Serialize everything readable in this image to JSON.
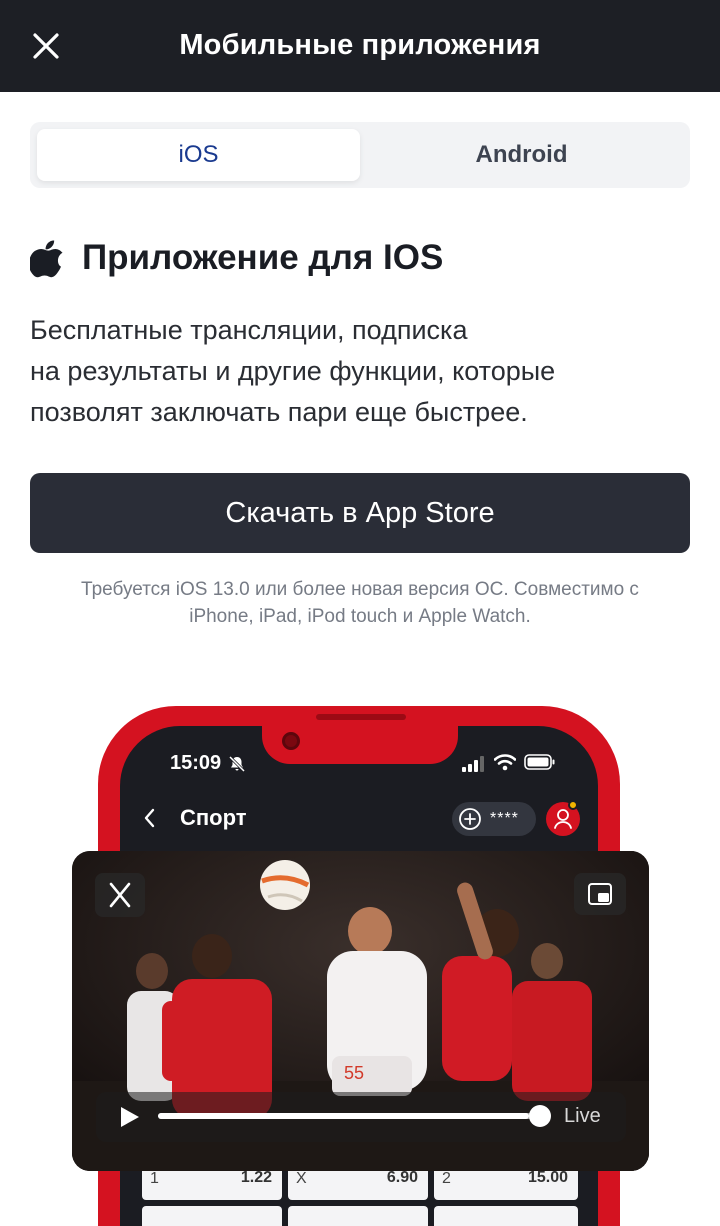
{
  "header": {
    "title": "Мобильные приложения"
  },
  "tabs": [
    {
      "label": "iOS",
      "active": true
    },
    {
      "label": "Android",
      "active": false
    }
  ],
  "section": {
    "title": "Приложение для IOS",
    "description_lines": [
      "Бесплатные трансляции, подписка",
      "на результаты и другие функции, которые",
      "позволят заключать пари еще быстрее."
    ]
  },
  "download": {
    "label": "Скачать в App Store"
  },
  "requirements": {
    "line1": "Требуется iOS 13.0 или более новая версия ОС. Совместимо с",
    "line2": "iPhone, iPad, iPod touch и Apple Watch."
  },
  "phone": {
    "status_time": "15:09",
    "screen_title": "Спорт",
    "balance_mask": "****",
    "odds": [
      {
        "outcome": "1",
        "value": "1.22"
      },
      {
        "outcome": "X",
        "value": "6.90"
      },
      {
        "outcome": "2",
        "value": "15.00"
      }
    ]
  },
  "video": {
    "live_label": "Live",
    "progress": 0.97
  },
  "colors": {
    "header_bg": "#1d1f25",
    "accent_red": "#d41220",
    "tab_active_text": "#1a3a8f",
    "button_bg": "#2a2d37"
  }
}
